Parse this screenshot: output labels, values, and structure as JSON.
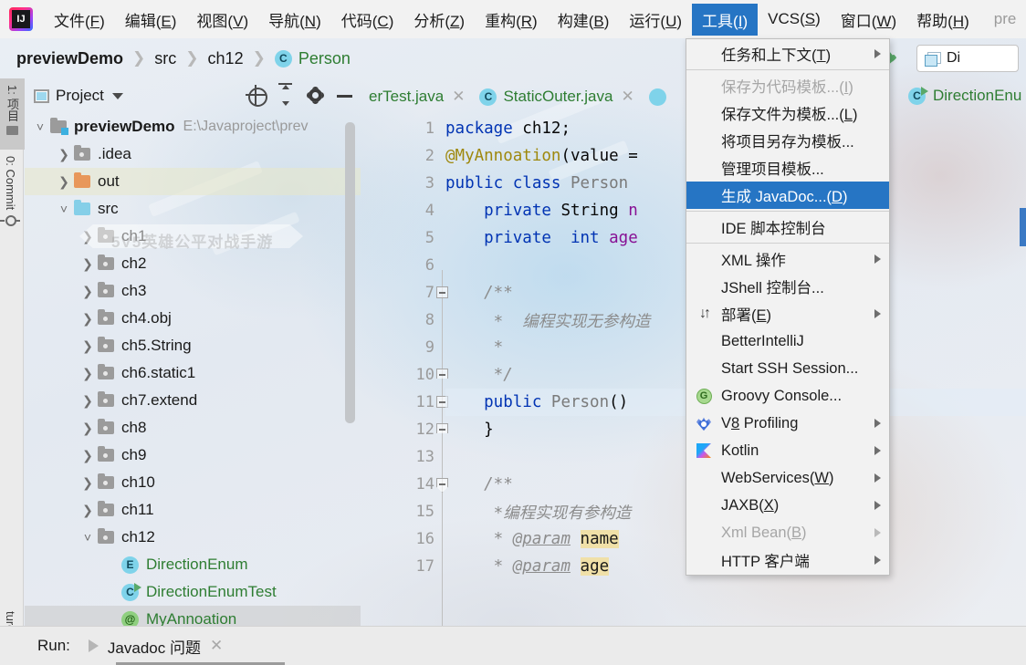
{
  "window": {
    "app_logo": "intellij-idea-logo",
    "title_partial": "pre"
  },
  "menubar": {
    "items": [
      {
        "label": "文件(F)",
        "mnemonic": "F",
        "active": false
      },
      {
        "label": "编辑(E)",
        "mnemonic": "E",
        "active": false
      },
      {
        "label": "视图(V)",
        "mnemonic": "V",
        "active": false
      },
      {
        "label": "导航(N)",
        "mnemonic": "N",
        "active": false
      },
      {
        "label": "代码(C)",
        "mnemonic": "C",
        "active": false
      },
      {
        "label": "分析(Z)",
        "mnemonic": "Z",
        "active": false
      },
      {
        "label": "重构(R)",
        "mnemonic": "R",
        "active": false
      },
      {
        "label": "构建(B)",
        "mnemonic": "B",
        "active": false
      },
      {
        "label": "运行(U)",
        "mnemonic": "U",
        "active": false
      },
      {
        "label": "工具(I)",
        "mnemonic": "I",
        "active": true
      },
      {
        "label": "VCS(S)",
        "mnemonic": "S",
        "active": false
      },
      {
        "label": "窗口(W)",
        "mnemonic": "W",
        "active": false
      },
      {
        "label": "帮助(H)",
        "mnemonic": "H",
        "active": false
      }
    ],
    "accent_color": "#2675c4"
  },
  "tools_menu": {
    "open": true,
    "selected_index": 5,
    "items": [
      {
        "label": "任务和上下文(T)",
        "submenu": true,
        "disabled": false,
        "icon": null
      },
      {
        "separator_after": true
      },
      {
        "label": "保存为代码模板...(I)",
        "submenu": false,
        "disabled": true,
        "icon": null
      },
      {
        "label": "保存文件为模板...(L)",
        "submenu": false,
        "disabled": false,
        "icon": null
      },
      {
        "label": "将项目另存为模板...",
        "submenu": false,
        "disabled": false,
        "icon": null
      },
      {
        "label": "管理项目模板...",
        "submenu": false,
        "disabled": false,
        "icon": null
      },
      {
        "label": "生成 JavaDoc...(D)",
        "submenu": false,
        "disabled": false,
        "selected": true,
        "icon": null
      },
      {
        "separator_after": true
      },
      {
        "label": "IDE 脚本控制台",
        "submenu": false,
        "disabled": false,
        "icon": null
      },
      {
        "separator_after": true
      },
      {
        "label": "XML 操作",
        "submenu": true,
        "disabled": false,
        "icon": null
      },
      {
        "label": "JShell 控制台...",
        "submenu": false,
        "disabled": false,
        "icon": null
      },
      {
        "label": "部署(E)",
        "submenu": true,
        "disabled": false,
        "icon": "deploy-icon"
      },
      {
        "label": "BetterIntelliJ",
        "submenu": false,
        "disabled": false,
        "icon": null
      },
      {
        "label": "Start SSH Session...",
        "submenu": false,
        "disabled": false,
        "icon": null
      },
      {
        "label": "Groovy Console...",
        "submenu": false,
        "disabled": false,
        "icon": "groovy-icon"
      },
      {
        "label": "V8 Profiling",
        "submenu": true,
        "disabled": false,
        "icon": "v8-icon"
      },
      {
        "label": "Kotlin",
        "submenu": true,
        "disabled": false,
        "icon": "kotlin-icon"
      },
      {
        "label": "WebServices(W)",
        "submenu": true,
        "disabled": false,
        "icon": null
      },
      {
        "label": "JAXB(X)",
        "submenu": true,
        "disabled": false,
        "icon": null
      },
      {
        "label": "Xml Bean(B)",
        "submenu": true,
        "disabled": true,
        "icon": null
      },
      {
        "label": "HTTP 客户端",
        "submenu": true,
        "disabled": false,
        "icon": null
      }
    ]
  },
  "breadcrumb": {
    "parts": [
      "previewDemo",
      "src",
      "ch12",
      "Person"
    ],
    "separator": "❯",
    "last_icon": "class-icon",
    "last_icon_letter": "C"
  },
  "toolbar": {
    "build_icon": "hammer-icon",
    "run_config_label": "Di",
    "run_config_icon": "window-icon"
  },
  "left_strip": {
    "buttons": [
      {
        "label": "1: 项目",
        "active": true,
        "icon": "folder-icon"
      },
      {
        "label": "0: Commit",
        "active": false,
        "icon": "commit-icon"
      }
    ],
    "bottom_label": "ture"
  },
  "project_panel": {
    "title": "Project",
    "tools": [
      "locate-icon",
      "collapse-all-icon",
      "gear-icon",
      "minimize-icon"
    ],
    "tree": [
      {
        "depth": 0,
        "twisty": "˅",
        "icon": "root-folder",
        "label": "previewDemo",
        "bold": true,
        "path": "E:\\Javaproject\\prev",
        "highlight": ""
      },
      {
        "depth": 1,
        "twisty": "❯",
        "icon": "gray-folder",
        "label": ".idea",
        "bold": false,
        "path": "",
        "highlight": ""
      },
      {
        "depth": 1,
        "twisty": "❯",
        "icon": "orange-folder",
        "label": "out",
        "bold": false,
        "path": "",
        "highlight": "out"
      },
      {
        "depth": 1,
        "twisty": "˅",
        "icon": "blue-folder",
        "label": "src",
        "bold": false,
        "path": "",
        "highlight": ""
      },
      {
        "depth": 2,
        "twisty": "❯",
        "icon": "pkg-folder",
        "label": "ch1",
        "bold": false,
        "path": "",
        "highlight": ""
      },
      {
        "depth": 2,
        "twisty": "❯",
        "icon": "pkg-folder",
        "label": "ch2",
        "bold": false,
        "path": "",
        "highlight": ""
      },
      {
        "depth": 2,
        "twisty": "❯",
        "icon": "pkg-folder",
        "label": "ch3",
        "bold": false,
        "path": "",
        "highlight": ""
      },
      {
        "depth": 2,
        "twisty": "❯",
        "icon": "pkg-folder",
        "label": "ch4.obj",
        "bold": false,
        "path": "",
        "highlight": ""
      },
      {
        "depth": 2,
        "twisty": "❯",
        "icon": "pkg-folder",
        "label": "ch5.String",
        "bold": false,
        "path": "",
        "highlight": ""
      },
      {
        "depth": 2,
        "twisty": "❯",
        "icon": "pkg-folder",
        "label": "ch6.static1",
        "bold": false,
        "path": "",
        "highlight": ""
      },
      {
        "depth": 2,
        "twisty": "❯",
        "icon": "pkg-folder",
        "label": "ch7.extend",
        "bold": false,
        "path": "",
        "highlight": ""
      },
      {
        "depth": 2,
        "twisty": "❯",
        "icon": "pkg-folder",
        "label": "ch8",
        "bold": false,
        "path": "",
        "highlight": ""
      },
      {
        "depth": 2,
        "twisty": "❯",
        "icon": "pkg-folder",
        "label": "ch9",
        "bold": false,
        "path": "",
        "highlight": ""
      },
      {
        "depth": 2,
        "twisty": "❯",
        "icon": "pkg-folder",
        "label": "ch10",
        "bold": false,
        "path": "",
        "highlight": ""
      },
      {
        "depth": 2,
        "twisty": "❯",
        "icon": "pkg-folder",
        "label": "ch11",
        "bold": false,
        "path": "",
        "highlight": ""
      },
      {
        "depth": 2,
        "twisty": "˅",
        "icon": "pkg-folder",
        "label": "ch12",
        "bold": false,
        "path": "",
        "highlight": ""
      },
      {
        "depth": 3,
        "twisty": "",
        "icon": "enum-icon",
        "label": "DirectionEnum",
        "bold": false,
        "path": "",
        "highlight": "",
        "green": true
      },
      {
        "depth": 3,
        "twisty": "",
        "icon": "class-run-icon",
        "label": "DirectionEnumTest",
        "bold": false,
        "path": "",
        "highlight": "",
        "green": true
      },
      {
        "depth": 3,
        "twisty": "",
        "icon": "annotation-icon",
        "label": "MyAnnoation",
        "bold": false,
        "path": "",
        "highlight": "sel",
        "green": true
      }
    ]
  },
  "editor": {
    "tabs": [
      {
        "label": "erTest.java",
        "icon": null,
        "closable": true,
        "active": false
      },
      {
        "label": "StaticOuter.java",
        "icon": "class-icon",
        "closable": true,
        "active": false
      }
    ],
    "current_line": 11,
    "lines": [
      {
        "n": 1,
        "fold": "",
        "tokens": [
          {
            "t": "package ",
            "c": "kw"
          },
          {
            "t": "ch12;",
            "c": "plain"
          }
        ]
      },
      {
        "n": 2,
        "fold": "",
        "tokens": [
          {
            "t": "@MyAnnoation",
            "c": "anno"
          },
          {
            "t": "(value =",
            "c": "plain"
          }
        ]
      },
      {
        "n": 3,
        "fold": "",
        "tokens": [
          {
            "t": "public class ",
            "c": "kw"
          },
          {
            "t": "Person",
            "c": "typ"
          }
        ]
      },
      {
        "n": 4,
        "fold": "",
        "tokens": [
          {
            "t": "    private ",
            "c": "kw"
          },
          {
            "t": "String ",
            "c": "plain"
          },
          {
            "t": "n",
            "c": "fld"
          }
        ]
      },
      {
        "n": 5,
        "fold": "",
        "tokens": [
          {
            "t": "    private  ",
            "c": "kw"
          },
          {
            "t": "int ",
            "c": "kw"
          },
          {
            "t": "age",
            "c": "fld"
          }
        ]
      },
      {
        "n": 6,
        "fold": "",
        "tokens": []
      },
      {
        "n": 7,
        "fold": "open",
        "tokens": [
          {
            "t": "    /**",
            "c": "cmt"
          }
        ]
      },
      {
        "n": 8,
        "fold": "bar",
        "tokens": [
          {
            "t": "     *  编程实现无参构造",
            "c": "cmt"
          }
        ]
      },
      {
        "n": 9,
        "fold": "bar",
        "tokens": [
          {
            "t": "     *",
            "c": "cmt"
          }
        ]
      },
      {
        "n": 10,
        "fold": "end",
        "tokens": [
          {
            "t": "     */",
            "c": "cmt"
          }
        ]
      },
      {
        "n": 11,
        "fold": "open",
        "tokens": [
          {
            "t": "    public ",
            "c": "kw"
          },
          {
            "t": "Person",
            "c": "typ"
          },
          {
            "t": "()",
            "c": "plain"
          }
        ]
      },
      {
        "n": 12,
        "fold": "end",
        "tokens": [
          {
            "t": "    }",
            "c": "plain"
          }
        ]
      },
      {
        "n": 13,
        "fold": "",
        "tokens": []
      },
      {
        "n": 14,
        "fold": "tip",
        "tokens": [
          {
            "t": "    /**",
            "c": "cmt"
          }
        ]
      },
      {
        "n": 15,
        "fold": "bar",
        "tokens": [
          {
            "t": "     *编程实现有参构造",
            "c": "cmt"
          }
        ]
      },
      {
        "n": 16,
        "fold": "bar",
        "tokens": [
          {
            "t": "     * ",
            "c": "cmt"
          },
          {
            "t": "@param",
            "c": "cmt-tag"
          },
          {
            "t": " ",
            "c": "cmt"
          },
          {
            "t": "name",
            "c": "hl-yellow"
          }
        ]
      },
      {
        "n": 17,
        "fold": "bar",
        "tokens": [
          {
            "t": "     * ",
            "c": "cmt"
          },
          {
            "t": "@param",
            "c": "cmt-tag"
          },
          {
            "t": " ",
            "c": "cmt"
          },
          {
            "t": "age",
            "c": "hl-yellow"
          }
        ]
      }
    ]
  },
  "right_panel": {
    "tab_label": "DirectionEnu",
    "tab_icon": "class-run-icon"
  },
  "run_panel": {
    "label": "Run:",
    "play_icon": "play-icon",
    "tab_label": "Javadoc 问题",
    "close_icon": "close-icon"
  },
  "watermark": {
    "text": "5V5英雄公平对战手游"
  },
  "colors": {
    "menu_highlight": "#2675c4",
    "java_green": "#2e7d32",
    "keyword_blue": "#0033b3",
    "annotation_gold": "#9e880d",
    "comment_gray": "#8c8c8c",
    "param_highlight": "#f0e0a8"
  }
}
